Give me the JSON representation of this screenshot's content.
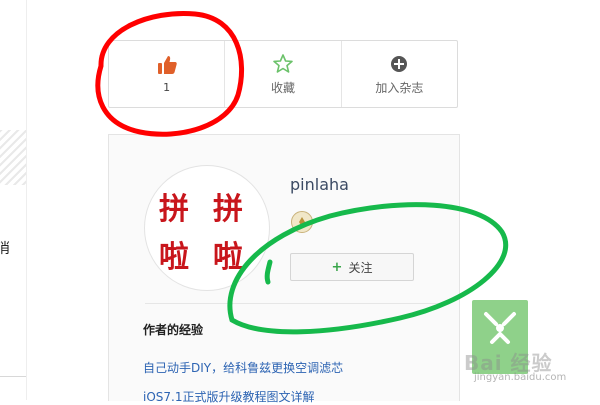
{
  "left_fragment": {
    "char": "消"
  },
  "actions": {
    "like": {
      "icon": "thumbs-up-icon",
      "count": "1"
    },
    "favorite": {
      "icon": "star-outline-icon",
      "label": "收藏"
    },
    "add_to_magazine": {
      "icon": "plus-circle-icon",
      "label": "加入杂志"
    }
  },
  "author": {
    "avatar_text": [
      "拼",
      "拼",
      "啦",
      "啦"
    ],
    "name": "pinlaha",
    "badge_icon": "rank-badge-icon",
    "follow_label": "关注"
  },
  "experiences": {
    "title": "作者的经验",
    "items": [
      "自己动手DIY，给科鲁兹更换空调滤芯",
      "iOS7.1正式版升级教程图文详解"
    ]
  },
  "watermark": {
    "text": "Bai 经验",
    "sub": "jingyan.baidu.com"
  },
  "colors": {
    "like_icon": "#e0602a",
    "star_icon": "#6cc26b",
    "link": "#2d64b3",
    "follow_plus": "#39a54a",
    "annotation_red": "#ff0000",
    "annotation_green": "#16b94b"
  }
}
